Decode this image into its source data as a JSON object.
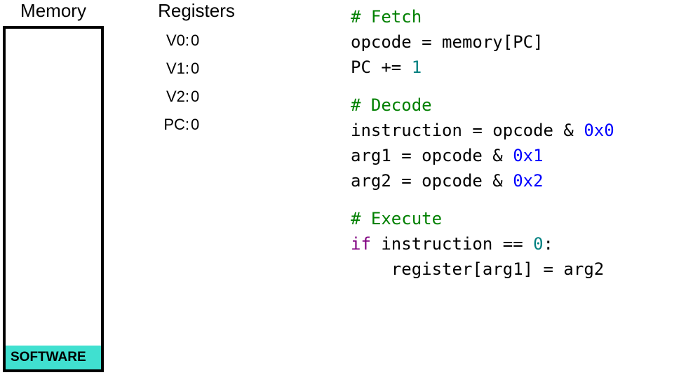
{
  "memory": {
    "title": "Memory",
    "software_label": "SOFTWARE"
  },
  "registers": {
    "title": "Registers",
    "items": [
      {
        "name": "V0:",
        "value": "0"
      },
      {
        "name": "V1:",
        "value": "0"
      },
      {
        "name": "V2:",
        "value": "0"
      },
      {
        "name": "PC:",
        "value": "0"
      }
    ]
  },
  "code": {
    "fetch_comment": "# Fetch",
    "fetch_line1_a": "opcode = memory[PC]",
    "fetch_line2_a": "PC += ",
    "fetch_line2_num": "1",
    "decode_comment": "# Decode",
    "decode_line1_a": "instruction = opcode & ",
    "decode_line1_hex": "0x0",
    "decode_line2_a": "arg1 = opcode & ",
    "decode_line2_hex": "0x1",
    "decode_line3_a": "arg2 = opcode & ",
    "decode_line3_hex": "0x2",
    "execute_comment": "# Execute",
    "execute_if": "if",
    "execute_line1_a": " instruction == ",
    "execute_line1_num": "0",
    "execute_line1_b": ":",
    "execute_line2_a": "    register[arg1] = arg2"
  }
}
